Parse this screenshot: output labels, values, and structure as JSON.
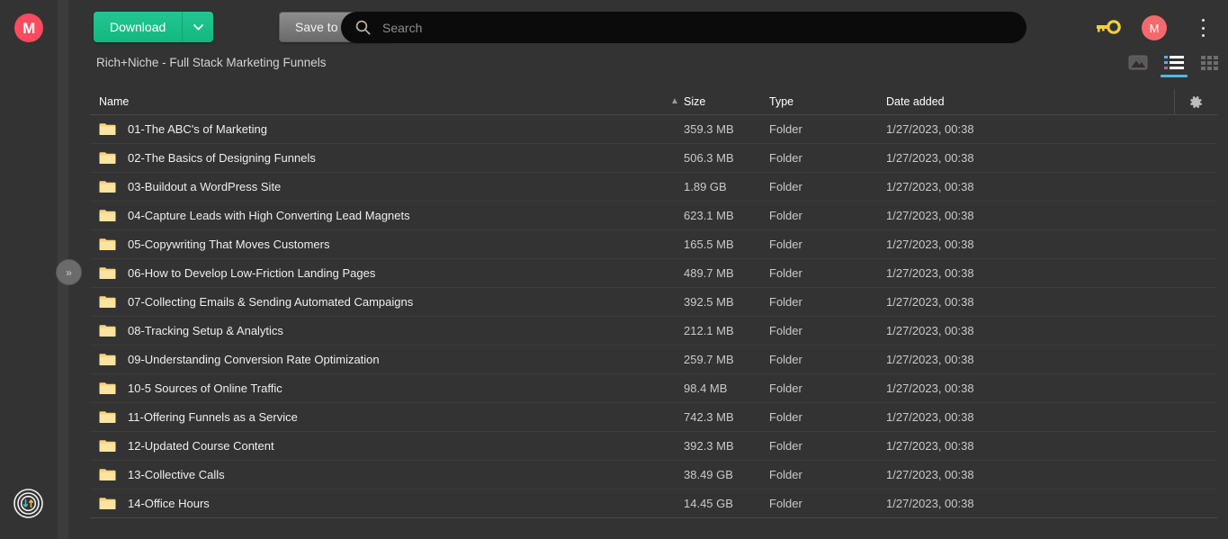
{
  "app": {
    "name": "MEGA",
    "logo_letter": "M",
    "accent_green": "#12b87e",
    "accent_blue": "#4fb8e8",
    "avatar_color": "#f4696c",
    "folder_color": "#f7d479",
    "background": "#333333"
  },
  "rail": {
    "logo_icon": "mega-logo-icon",
    "transfer_icon": "transfer-status-icon",
    "expand_handle_label": "»"
  },
  "toolbar": {
    "download_label": "Download",
    "download_caret_icon": "chevron-down-icon",
    "save_to_mega_label": "Save to MEGA",
    "key_icon": "key-icon",
    "avatar_letter": "M",
    "kebab_icon": "more-vertical-icon"
  },
  "search": {
    "placeholder": "Search",
    "value": "",
    "icon": "search-icon"
  },
  "breadcrumb": {
    "path": "Rich+Niche - Full Stack Marketing Funnels"
  },
  "view_toggles": [
    {
      "name": "media-view",
      "icon": "image-icon",
      "active": false
    },
    {
      "name": "list-view",
      "icon": "list-icon",
      "active": true
    },
    {
      "name": "grid-view",
      "icon": "grid-icon",
      "active": false
    }
  ],
  "table": {
    "columns": {
      "name": "Name",
      "size": "Size",
      "type": "Type",
      "date_added": "Date added"
    },
    "sort": {
      "column": "Name",
      "direction": "asc",
      "icon": "caret-up-icon"
    },
    "settings_icon": "gear-icon",
    "rows": [
      {
        "icon": "folder-icon",
        "name": "01-The ABC's of Marketing",
        "size": "359.3 MB",
        "type": "Folder",
        "date": "1/27/2023, 00:38"
      },
      {
        "icon": "folder-icon",
        "name": "02-The Basics of Designing Funnels",
        "size": "506.3 MB",
        "type": "Folder",
        "date": "1/27/2023, 00:38"
      },
      {
        "icon": "folder-icon",
        "name": "03-Buildout a WordPress Site",
        "size": "1.89 GB",
        "type": "Folder",
        "date": "1/27/2023, 00:38"
      },
      {
        "icon": "folder-icon",
        "name": "04-Capture Leads with High Converting Lead Magnets",
        "size": "623.1 MB",
        "type": "Folder",
        "date": "1/27/2023, 00:38"
      },
      {
        "icon": "folder-icon",
        "name": "05-Copywriting That Moves Customers",
        "size": "165.5 MB",
        "type": "Folder",
        "date": "1/27/2023, 00:38"
      },
      {
        "icon": "folder-icon",
        "name": "06-How to Develop Low-Friction Landing Pages",
        "size": "489.7 MB",
        "type": "Folder",
        "date": "1/27/2023, 00:38"
      },
      {
        "icon": "folder-icon",
        "name": "07-Collecting Emails & Sending Automated Campaigns",
        "size": "392.5 MB",
        "type": "Folder",
        "date": "1/27/2023, 00:38"
      },
      {
        "icon": "folder-icon",
        "name": "08-Tracking Setup & Analytics",
        "size": "212.1 MB",
        "type": "Folder",
        "date": "1/27/2023, 00:38"
      },
      {
        "icon": "folder-icon",
        "name": "09-Understanding Conversion Rate Optimization",
        "size": "259.7 MB",
        "type": "Folder",
        "date": "1/27/2023, 00:38"
      },
      {
        "icon": "folder-icon",
        "name": "10-5 Sources of Online Traffic",
        "size": "98.4 MB",
        "type": "Folder",
        "date": "1/27/2023, 00:38"
      },
      {
        "icon": "folder-icon",
        "name": "11-Offering Funnels as a Service",
        "size": "742.3 MB",
        "type": "Folder",
        "date": "1/27/2023, 00:38"
      },
      {
        "icon": "folder-icon",
        "name": "12-Updated Course Content",
        "size": "392.3 MB",
        "type": "Folder",
        "date": "1/27/2023, 00:38"
      },
      {
        "icon": "folder-icon",
        "name": "13-Collective Calls",
        "size": "38.49 GB",
        "type": "Folder",
        "date": "1/27/2023, 00:38"
      },
      {
        "icon": "folder-icon",
        "name": "14-Office Hours",
        "size": "14.45 GB",
        "type": "Folder",
        "date": "1/27/2023, 00:38"
      }
    ]
  }
}
